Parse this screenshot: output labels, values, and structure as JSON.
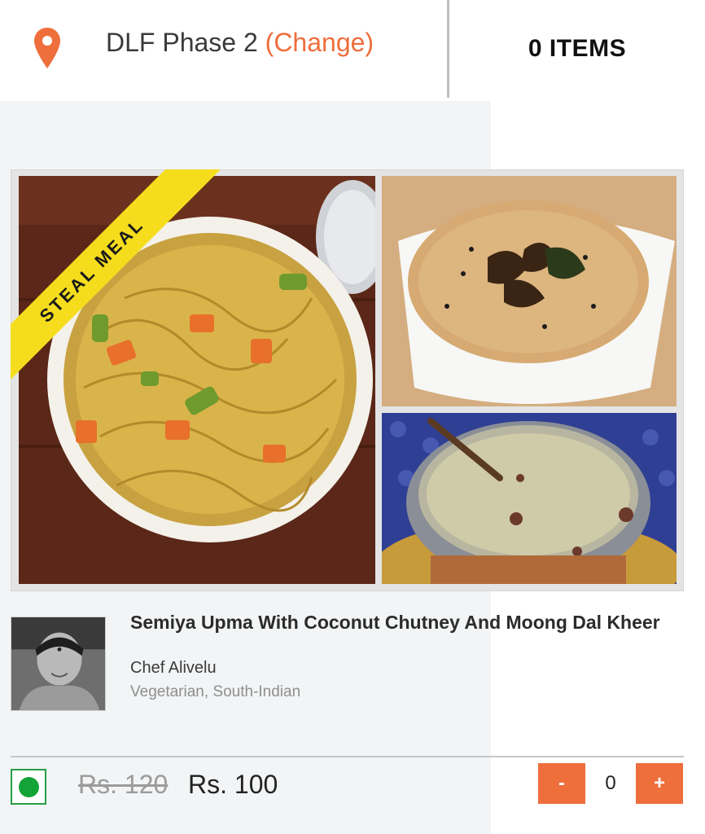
{
  "header": {
    "location": "DLF Phase 2",
    "change_label": "(Change)",
    "items_label": "0 ITEMS"
  },
  "meal": {
    "badge": "STEAL MEAL",
    "title": "Semiya Upma With Coconut Chutney And Moong Dal Kheer",
    "chef": "Chef Alivelu",
    "cuisine": "Vegetarian, South-Indian",
    "price_original": "Rs. 120",
    "price_current": "Rs. 100",
    "quantity": "0",
    "minus_label": "-",
    "plus_label": "+"
  },
  "icons": {
    "location": "location-pin-icon",
    "veg": "veg-mark-icon"
  },
  "colors": {
    "accent": "#ee6e3c",
    "badge": "#f5dd1e",
    "veg": "#14a337"
  }
}
